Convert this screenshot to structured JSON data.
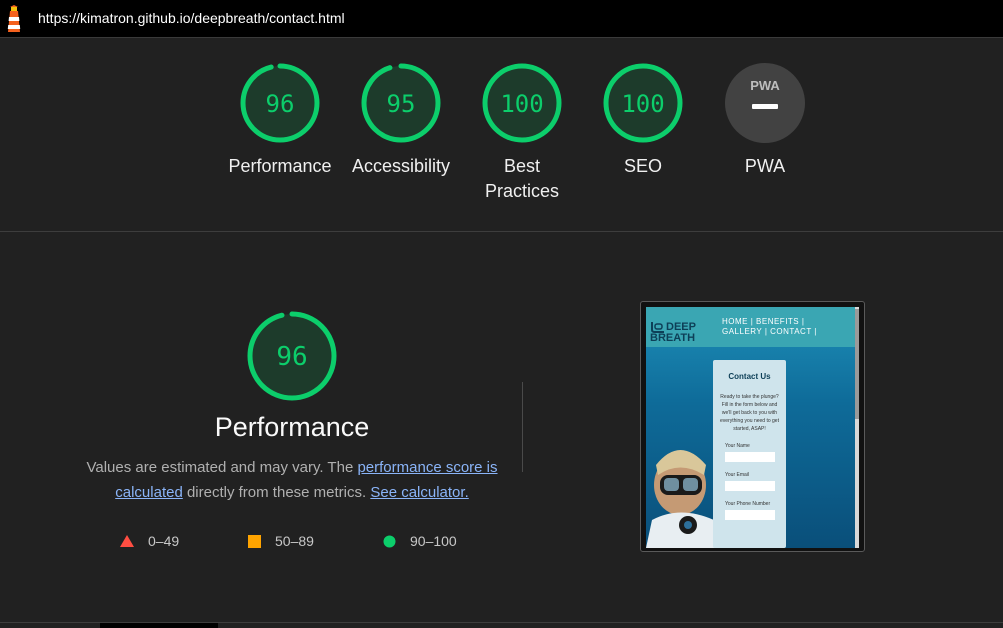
{
  "header": {
    "url": "https://kimatron.github.io/deepbreath/contact.html",
    "logo_icon": "lighthouse-icon"
  },
  "gauges": [
    {
      "score": "96",
      "label_lines": [
        "Performance"
      ],
      "ratio": 0.96,
      "color": "#0cce6b"
    },
    {
      "score": "95",
      "label_lines": [
        "Accessibility"
      ],
      "ratio": 0.95,
      "color": "#0cce6b"
    },
    {
      "score": "100",
      "label_lines": [
        "Best",
        "Practices"
      ],
      "ratio": 1.0,
      "color": "#0cce6b"
    },
    {
      "score": "100",
      "label_lines": [
        "SEO"
      ],
      "ratio": 1.0,
      "color": "#0cce6b"
    },
    {
      "score": "",
      "label_lines": [
        "PWA"
      ],
      "ratio": 0,
      "color": "#9e9e9e",
      "badge": "PWA",
      "badge_icon": "pwa-dash-icon"
    }
  ],
  "performance": {
    "score": "96",
    "ratio": 0.96,
    "title": "Performance",
    "desc_1": "Values are estimated and may vary. The ",
    "link_score": "performance score is calculated",
    "desc_2": " directly from these metrics. ",
    "link_calc": "See calculator."
  },
  "legend": [
    {
      "range": "0–49",
      "shape": "triangle",
      "color": "#ff4e42"
    },
    {
      "range": "50–89",
      "shape": "square",
      "color": "#ffa400"
    },
    {
      "range": "90–100",
      "shape": "circle",
      "color": "#0cce6b"
    }
  ],
  "screenshot": {
    "brand_line1": "DEEP",
    "brand_line2": "BREATH",
    "nav_line1": "HOME | BENEFITS |",
    "nav_line2": "GALLERY | CONTACT |",
    "card_title": "Contact Us",
    "card_text": "Ready to take the plunge? Fill in the form below and we'll get back to you with everything you need to get started, ASAP!",
    "field_name": "Your Name",
    "field_email": "Your Email",
    "field_phone": "Your Phone Number"
  },
  "colors": {
    "pass": "#0cce6b",
    "average": "#ffa400",
    "fail": "#ff4e42",
    "background": "#212121"
  }
}
